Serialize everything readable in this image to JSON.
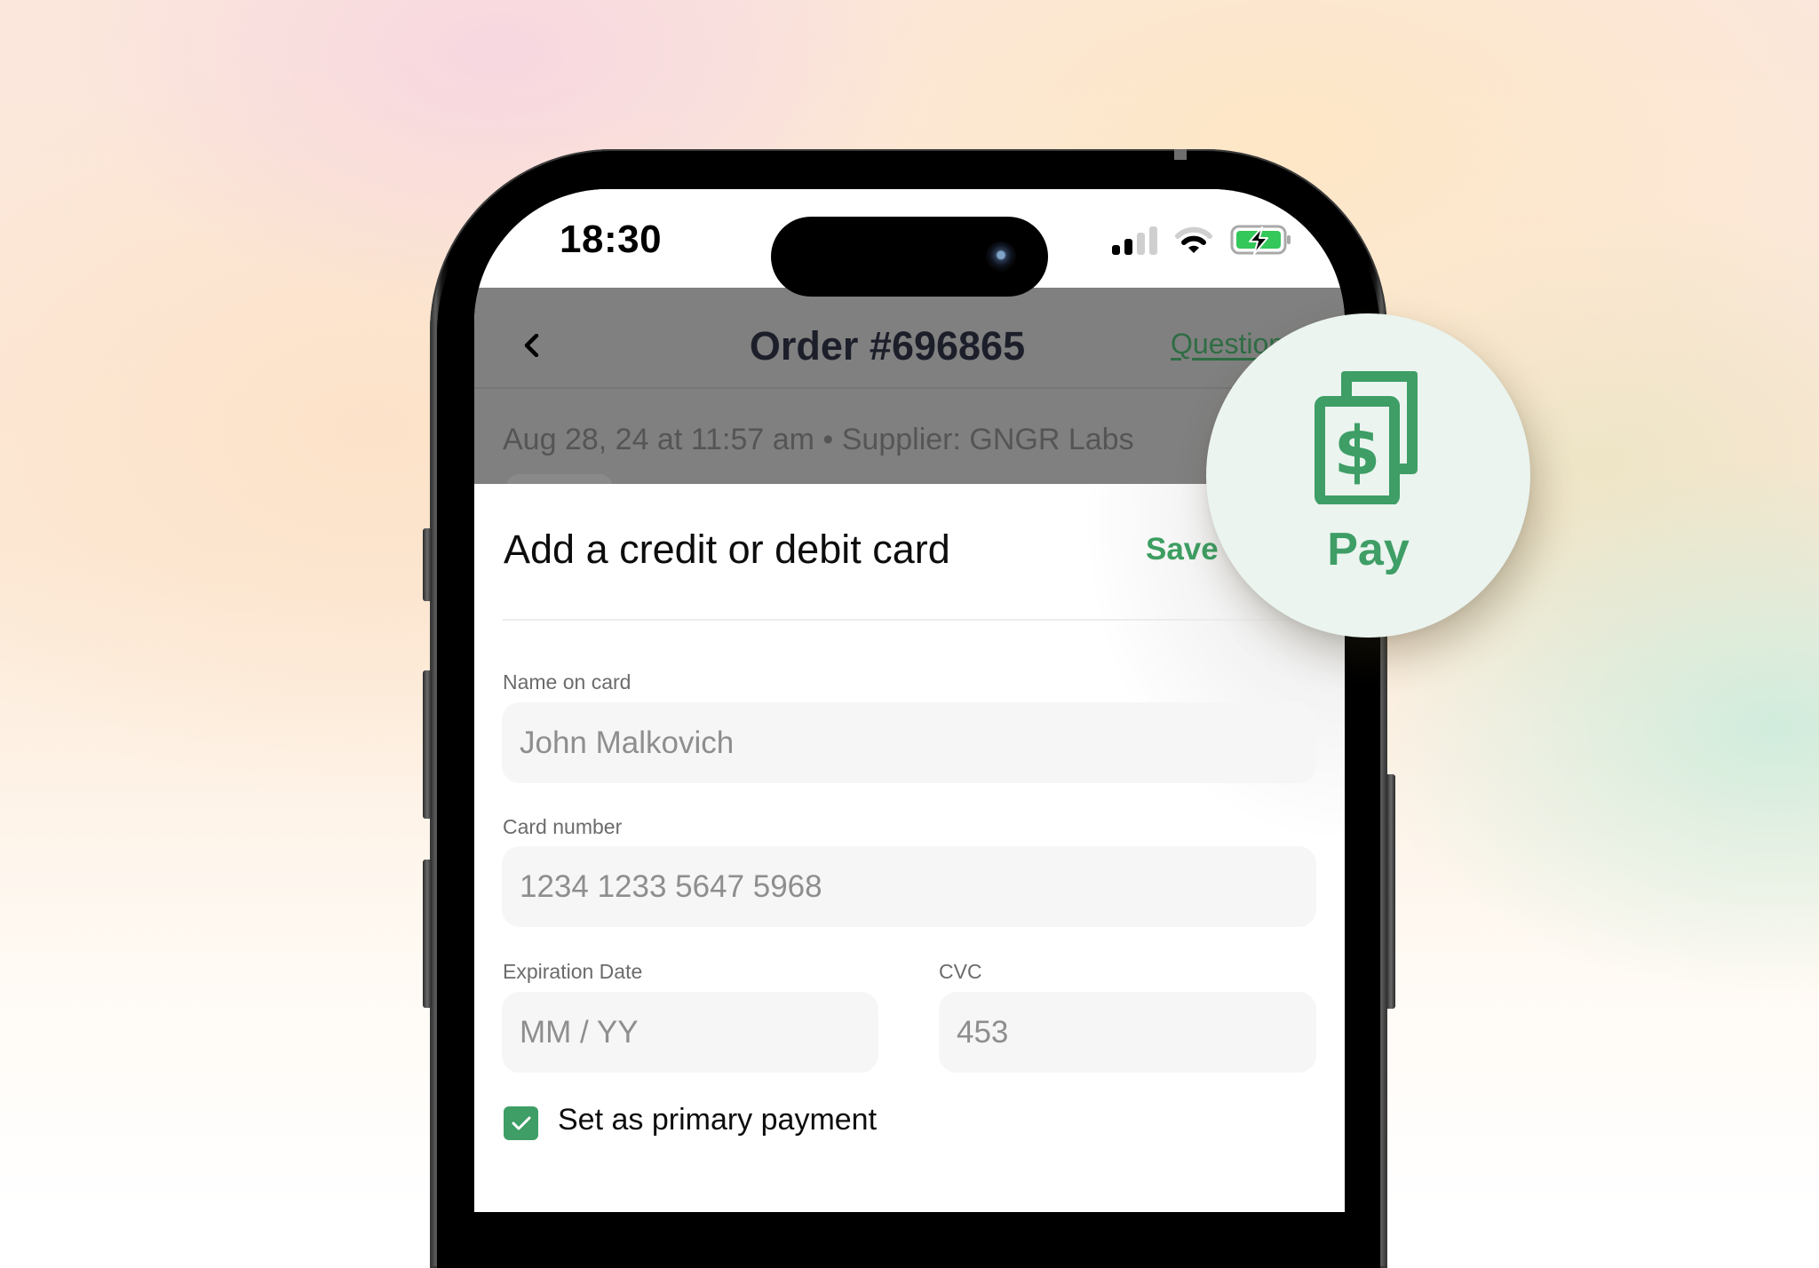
{
  "status_bar": {
    "time": "18:30",
    "signal_bars_active": 2,
    "signal_bars_total": 4,
    "battery_state": "charging",
    "icons": [
      "signal-icon",
      "wifi-icon",
      "battery-charging-icon"
    ]
  },
  "header": {
    "back_icon": "chevron-left-icon",
    "title": "Order #696865",
    "questions_link": "Questions",
    "subtitle": "Aug 28, 24 at 11:57 am • Supplier: GNGR Labs"
  },
  "sheet": {
    "title": "Add a credit or debit card",
    "save_label": "Save",
    "fields": {
      "name": {
        "label": "Name on card",
        "placeholder": "John Malkovich",
        "value": ""
      },
      "card_number": {
        "label": "Card number",
        "placeholder": "1234 1233 5647 5968",
        "value": ""
      },
      "expiration": {
        "label": "Expiration Date",
        "placeholder": "MM / YY",
        "value": ""
      },
      "cvc": {
        "label": "CVC",
        "placeholder": "453",
        "value": ""
      }
    },
    "primary_checkbox": {
      "label": "Set as primary payment",
      "checked": true
    }
  },
  "badge": {
    "icon": "money-bills-icon",
    "label": "Pay"
  },
  "colors": {
    "accent_green": "#3e9e66",
    "badge_bg": "#ebf4ef",
    "overlay_gray": "#808080"
  }
}
